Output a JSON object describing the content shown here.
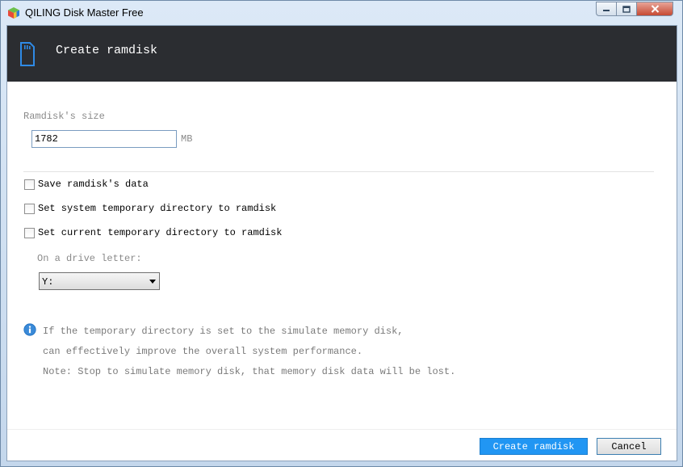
{
  "window": {
    "title": "QILING Disk Master Free"
  },
  "header": {
    "title": "Create ramdisk",
    "icon": "sd-card-icon"
  },
  "size": {
    "label": "Ramdisk's size",
    "value": "1782",
    "unit": "MB"
  },
  "options": [
    {
      "label": "Save ramdisk's data",
      "checked": false
    },
    {
      "label": "Set system temporary directory to ramdisk",
      "checked": false
    },
    {
      "label": "Set current temporary directory to ramdisk",
      "checked": false
    }
  ],
  "drive": {
    "label": "On a drive letter:",
    "selected": "Y:"
  },
  "info": {
    "lines": [
      "If the temporary directory is set to the simulate memory disk,",
      "can effectively improve the overall system performance.",
      "Note: Stop to simulate memory disk, that memory disk data will be lost."
    ]
  },
  "buttons": {
    "create": "Create ramdisk",
    "cancel": "Cancel"
  },
  "colors": {
    "header_bg": "#2b2d31",
    "accent": "#2196f3",
    "info_icon": "#3a8ad8"
  }
}
